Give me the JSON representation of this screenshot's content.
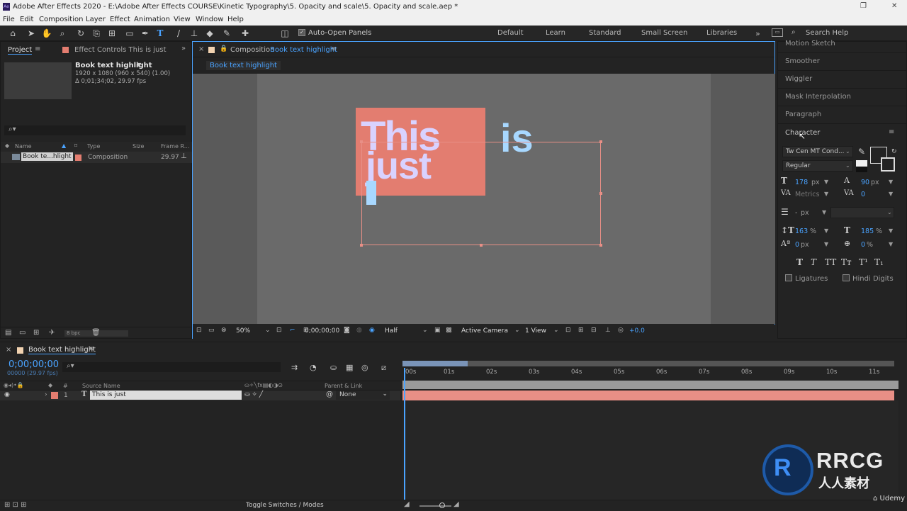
{
  "window": {
    "title": "Adobe After Effects 2020 - E:\\Adobe After Effects COURSE\\Kinetic Typography\\5. Opacity and scale\\5. Opacity and scale.aep *",
    "app_icon": "Ae"
  },
  "menu": [
    "File",
    "Edit",
    "Composition",
    "Layer",
    "Effect",
    "Animation",
    "View",
    "Window",
    "Help"
  ],
  "toolbar": {
    "auto_open_label": "Auto-Open Panels",
    "workspaces": [
      "Default",
      "Learn",
      "Standard",
      "Small Screen",
      "Libraries"
    ],
    "search_placeholder": "Search Help"
  },
  "project": {
    "tab": "Project",
    "effect_tab": "Effect Controls This is just",
    "comp_name": "Book text highlight",
    "comp_info1": "1920 x 1080  (960 x 540) (1.00)",
    "comp_info2": "Δ 0;01;34;02, 29.97 fps",
    "cols": {
      "name": "Name",
      "type": "Type",
      "size": "Size",
      "framerate": "Frame R..."
    },
    "item": {
      "name": "Book te...hlight",
      "type": "Composition",
      "fps": "29.97"
    },
    "bpc": "8 bpc"
  },
  "composition": {
    "tab_prefix": "Composition",
    "tab_name": "Book text highlight",
    "flow": "Book text highlight",
    "text_this": "This",
    "text_is": "is",
    "text_just": "just",
    "zoom": "50%",
    "timecode": "0;00;00;00",
    "resolution": "Half",
    "camera": "Active Camera",
    "view": "1 View",
    "exposure": "+0.0"
  },
  "right_panels": [
    "Motion Sketch",
    "Smoother",
    "Wiggler",
    "Mask Interpolation",
    "Paragraph"
  ],
  "character": {
    "title": "Character",
    "font": "Tw Cen MT Cond...",
    "style": "Regular",
    "font_size": "178",
    "leading": "90",
    "kerning": "Metrics",
    "tracking": "0",
    "stroke": "-",
    "unit_px": "px",
    "vscale": "163",
    "hscale": "185",
    "baseline": "0",
    "tsume": "0",
    "unit_pct": "%",
    "ligatures": "Ligatures",
    "hindi": "Hindi Digits",
    "fill_color": "#a8d8ff"
  },
  "timeline": {
    "tab": "Book text highlight",
    "timecode": "0;00;00;00",
    "frames": "00000 (29.97 fps)",
    "cols": {
      "source": "Source Name",
      "parent": "Parent & Link"
    },
    "layer": {
      "num": "1",
      "name": "This is just",
      "parent": "None"
    },
    "ticks": [
      "00s",
      "01s",
      "02s",
      "03s",
      "04s",
      "05s",
      "06s",
      "07s",
      "08s",
      "09s",
      "10s",
      "11s"
    ],
    "toggle": "Toggle Switches / Modes"
  },
  "watermark": {
    "brand": "RRCG",
    "sub": "人人素材",
    "udemy": "Udemy"
  },
  "colors": {
    "accent": "#4aa3ff",
    "layer_bar": "#e88f86",
    "highlight_box": "#e37d70",
    "text_fill": "#d9d2ff"
  }
}
